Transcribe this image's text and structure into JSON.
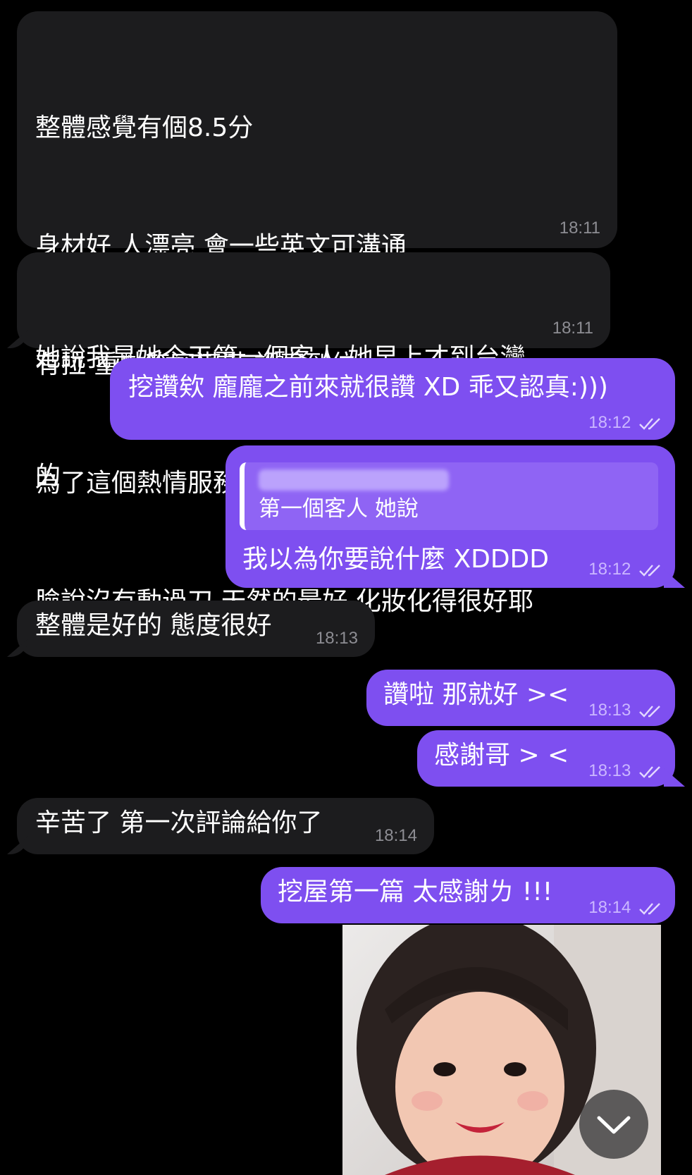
{
  "messages": [
    {
      "dir": "in",
      "lines": [
        "整體感覺有個8.5分",
        "身材好 人漂亮 會一些英文可溝通",
        "有拉 重點笑容滿滿 認真到位",
        "為了這個熱情服務 再來都值得",
        "臉說沒有動過刀 天然的最好 化妝化得很好耶"
      ],
      "time": "18:11"
    },
    {
      "dir": "in",
      "lines": [
        "她說我是她今天第一個客人 她早上才到台灣",
        "的"
      ],
      "time": "18:11"
    },
    {
      "dir": "out",
      "text": "挖讚欸 龐龐之前來就很讚 XD 乖又認真:)))",
      "time": "18:12"
    },
    {
      "dir": "out",
      "quote": "第一個客人 她說",
      "text": "我以為你要說什麼 XDDDD",
      "time": "18:12"
    },
    {
      "dir": "in",
      "text": "整體是好的 態度很好",
      "time": "18:13"
    },
    {
      "dir": "out",
      "text": "讚啦 那就好 ><",
      "time": "18:13"
    },
    {
      "dir": "out",
      "text": "感謝哥 > <",
      "time": "18:13"
    },
    {
      "dir": "in",
      "text": "辛苦了 第一次評論給你了",
      "time": "18:14"
    },
    {
      "dir": "out",
      "text": "挖屋第一篇 太感謝ㄌ !!!",
      "time": "18:14"
    }
  ],
  "photo": {
    "description_icon": "smiling-child-photo"
  },
  "scroll_button": {
    "icon": "chevron-down-icon"
  },
  "colors": {
    "incoming": "#1c1c1e",
    "outgoing": "#7e4ff0",
    "background": "#000000"
  }
}
